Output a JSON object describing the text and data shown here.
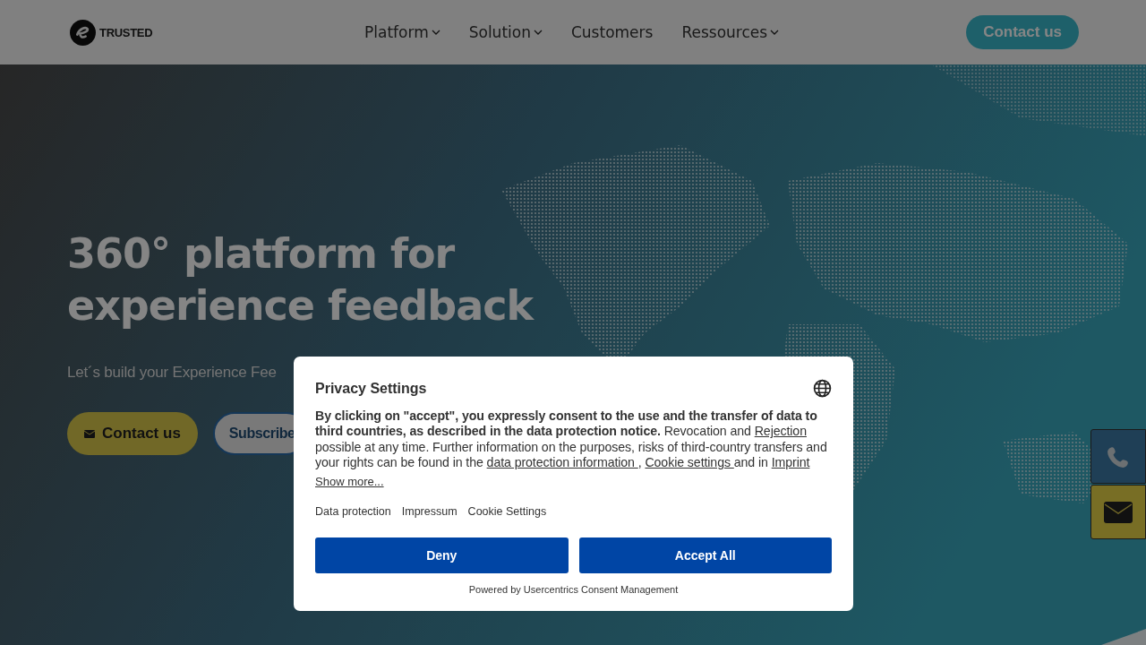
{
  "header": {
    "logo": {
      "text": "TRUSTED"
    },
    "nav": [
      {
        "label": "Platform",
        "dropdown": true
      },
      {
        "label": "Solution",
        "dropdown": true
      },
      {
        "label": "Customers",
        "dropdown": false
      },
      {
        "label": "Ressources",
        "dropdown": true
      }
    ],
    "cta": "Contact us"
  },
  "hero": {
    "title": "360° platform for experience feedback",
    "subtitle": "Let´s build your Experience Fee",
    "buttons": [
      {
        "label": "Contact us",
        "kind": "primary"
      },
      {
        "label": "Subscribe",
        "kind": "secondary"
      }
    ]
  },
  "side_buttons": [
    {
      "kind": "phone"
    },
    {
      "kind": "email"
    }
  ],
  "consent": {
    "title": "Privacy Settings",
    "body": [
      {
        "kind": "bold",
        "text": "By clicking on \"accept\", you expressly consent to the use and the transfer of data to third countries, as described in the data protection notice."
      },
      {
        "kind": "text",
        "text": " Revocation and "
      },
      {
        "kind": "link",
        "text": "Rejection"
      },
      {
        "kind": "text",
        "text": " possible at any time. Further information on the purposes, risks of third-country transfers and your rights can be found in the "
      },
      {
        "kind": "link",
        "text": "data protection information "
      },
      {
        "kind": "text",
        "text": ", "
      },
      {
        "kind": "link",
        "text": "Cookie settings "
      },
      {
        "kind": "text",
        "text": "and in "
      },
      {
        "kind": "link",
        "text": "Imprint"
      }
    ],
    "show_more": "Show more...",
    "links": [
      "Data protection",
      "Impressum",
      "Cookie Settings"
    ],
    "buttons": [
      "Deny",
      "Accept All"
    ],
    "powered_by": "Powered by Usercentrics Consent Management"
  }
}
